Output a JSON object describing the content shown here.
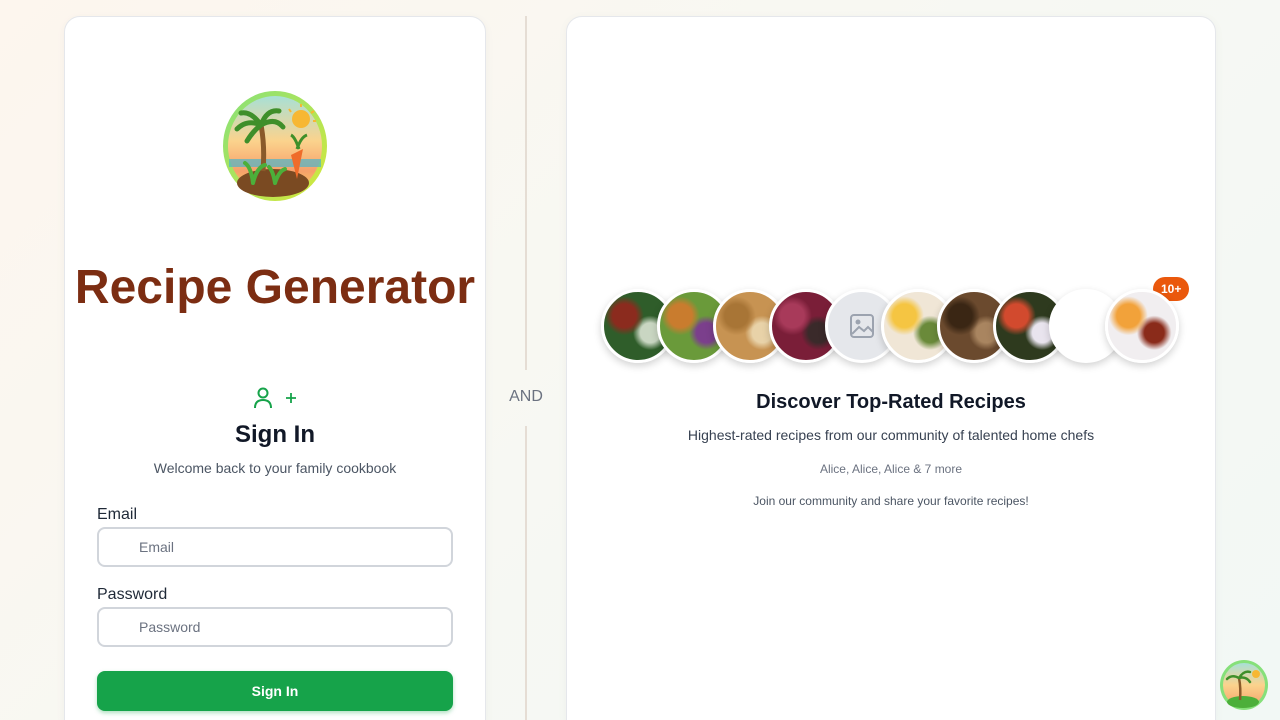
{
  "app": {
    "title": "Recipe Generator",
    "accent_color": "#16a34a",
    "title_color": "#7c2d12",
    "logo_icon": "palm-tree-island-logo"
  },
  "signin": {
    "heading": "Sign In",
    "subtitle": "Welcome back to your family cookbook",
    "mode_icons": [
      "user-icon",
      "plus-icon"
    ],
    "email_label": "Email",
    "email_placeholder": "Email",
    "email_value": "",
    "password_label": "Password",
    "password_placeholder": "Password",
    "password_value": "",
    "submit_label": "Sign In"
  },
  "divider": {
    "label": "AND"
  },
  "showcase": {
    "avatars": [
      {
        "name": "salad-bowl",
        "colors": [
          "#2f5d2a",
          "#8b2b1e",
          "#c9d6c2"
        ]
      },
      {
        "name": "veggie-bowl",
        "colors": [
          "#6a9a3a",
          "#c97c2e",
          "#7b3f8c"
        ]
      },
      {
        "name": "fritter-plate",
        "colors": [
          "#c79352",
          "#a87536",
          "#e8d2a8"
        ]
      },
      {
        "name": "berry-smoothie",
        "colors": [
          "#7a1e38",
          "#a83a5a",
          "#3a2a2a"
        ]
      },
      {
        "name": "image-placeholder",
        "colors": [
          "#e5e7eb",
          "#9ca3af",
          "#e5e7eb"
        ]
      },
      {
        "name": "egg-toast",
        "colors": [
          "#f0e6d6",
          "#f5c542",
          "#6a8a3a"
        ]
      },
      {
        "name": "braised-meat",
        "colors": [
          "#6b4a2e",
          "#3a2614",
          "#a98560"
        ]
      },
      {
        "name": "garden-salad",
        "colors": [
          "#2e3a1e",
          "#d24a2e",
          "#e9e4ee"
        ]
      },
      {
        "name": "blank",
        "colors": [
          "#ffffff",
          "#ffffff",
          "#ffffff"
        ]
      },
      {
        "name": "eggs-and-beans",
        "colors": [
          "#f1eef0",
          "#f2a23a",
          "#8a2b1a"
        ]
      }
    ],
    "more_badge": "10+",
    "title": "Discover Top-Rated Recipes",
    "subtitle": "Highest-rated recipes from our community of talented home chefs",
    "contributors": "Alice, Alice, Alice & 7 more",
    "join_text": "Join our community and share your favorite recipes!"
  }
}
